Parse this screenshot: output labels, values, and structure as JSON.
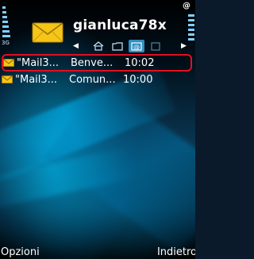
{
  "status": {
    "network_label": "3G",
    "indicator": "@"
  },
  "header": {
    "title": "gianluca78x",
    "icon": "envelope-icon",
    "tabs": [
      {
        "icon": "home-mailbox-icon",
        "active": false
      },
      {
        "icon": "folder-icon",
        "active": false
      },
      {
        "icon": "mail-at-icon",
        "active": true
      },
      {
        "icon": "box-icon",
        "active": false
      }
    ]
  },
  "messages": [
    {
      "sender": "\"Mail3...",
      "subject": "Benve...",
      "time": "10:02",
      "selected": true
    },
    {
      "sender": "\"Mail3...",
      "subject": "Comun...",
      "time": "10:00",
      "selected": false
    }
  ],
  "softkeys": {
    "left": "Opzioni",
    "right": "Indietro"
  },
  "colors": {
    "selection": "#e01020",
    "envelope": "#f5c518",
    "accent": "#2f8fbf"
  }
}
